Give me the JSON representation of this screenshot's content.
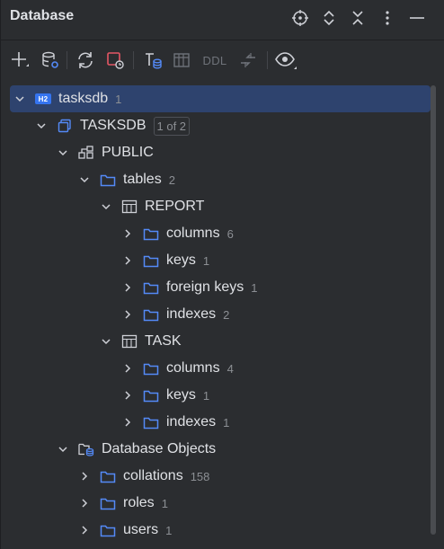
{
  "window": {
    "title": "Database"
  },
  "toolbar": {
    "ddl_label": "DDL"
  },
  "tree": {
    "datasource": {
      "label": "tasksdb",
      "count": "1",
      "icon_text": "H2"
    },
    "database": {
      "label": "TASKSDB",
      "badge": "1 of 2"
    },
    "schema": {
      "label": "PUBLIC"
    },
    "tables": {
      "label": "tables",
      "count": "2"
    },
    "report": {
      "label": "REPORT",
      "columns": {
        "label": "columns",
        "count": "6"
      },
      "keys": {
        "label": "keys",
        "count": "1"
      },
      "foreign_keys": {
        "label": "foreign keys",
        "count": "1"
      },
      "indexes": {
        "label": "indexes",
        "count": "2"
      }
    },
    "task": {
      "label": "TASK",
      "columns": {
        "label": "columns",
        "count": "4"
      },
      "keys": {
        "label": "keys",
        "count": "1"
      },
      "indexes": {
        "label": "indexes",
        "count": "1"
      }
    },
    "db_objects": {
      "label": "Database Objects"
    },
    "collations": {
      "label": "collations",
      "count": "158"
    },
    "roles": {
      "label": "roles",
      "count": "1"
    },
    "users": {
      "label": "users",
      "count": "1"
    }
  },
  "colors": {
    "accent": "#3574f0",
    "selection": "#2e436e",
    "folder": "#548af7"
  }
}
